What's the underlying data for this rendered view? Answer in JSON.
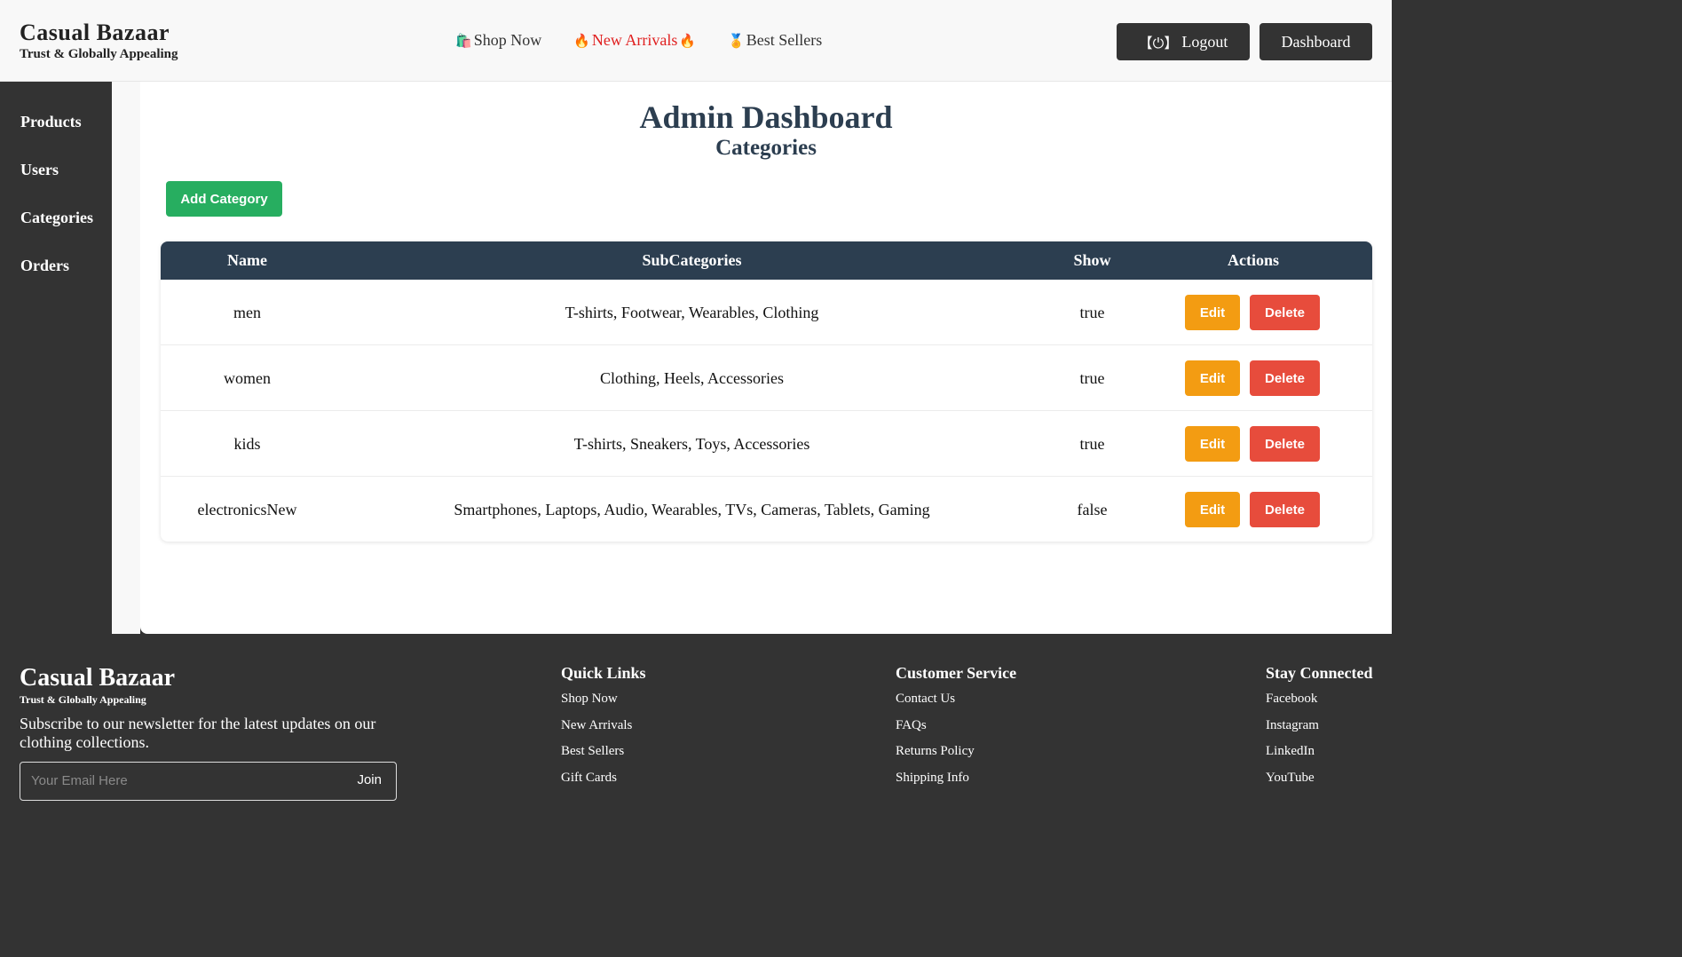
{
  "header": {
    "brand_name": "Casual Bazaar",
    "brand_tagline": "Trust & Globally Appealing",
    "nav": [
      {
        "icon": "🛍️",
        "label": "Shop Now"
      },
      {
        "icon": "🔥",
        "label": "New Arrivals",
        "icon_after": "🔥"
      },
      {
        "icon": "🏅",
        "label": "Best Sellers"
      }
    ],
    "logout_icon": "【⏻】",
    "logout_label": "Logout",
    "dashboard_label": "Dashboard"
  },
  "sidebar": {
    "items": [
      {
        "label": "Products"
      },
      {
        "label": "Users"
      },
      {
        "label": "Categories"
      },
      {
        "label": "Orders"
      }
    ]
  },
  "main": {
    "title": "Admin Dashboard",
    "subtitle": "Categories",
    "add_button_label": "Add Category",
    "table": {
      "headers": [
        "Name",
        "SubCategories",
        "Show",
        "Actions"
      ],
      "rows": [
        {
          "name": "men",
          "subcategories": "T-shirts, Footwear, Wearables, Clothing",
          "show": "true"
        },
        {
          "name": "women",
          "subcategories": "Clothing, Heels, Accessories",
          "show": "true"
        },
        {
          "name": "kids",
          "subcategories": "T-shirts, Sneakers, Toys, Accessories",
          "show": "true"
        },
        {
          "name": "electronicsNew",
          "subcategories": "Smartphones, Laptops, Audio, Wearables, TVs, Cameras, Tablets, Gaming",
          "show": "false"
        }
      ],
      "edit_label": "Edit",
      "delete_label": "Delete"
    }
  },
  "footer": {
    "brand_name": "Casual Bazaar",
    "brand_tagline": "Trust & Globally Appealing",
    "newsletter_text": "Subscribe to our newsletter for the latest updates on our clothing collections.",
    "email_placeholder": "Your Email Here",
    "join_label": "Join",
    "columns": [
      {
        "title": "Quick Links",
        "links": [
          "Shop Now",
          "New Arrivals",
          "Best Sellers",
          "Gift Cards"
        ]
      },
      {
        "title": "Customer Service",
        "links": [
          "Contact Us",
          "FAQs",
          "Returns Policy",
          "Shipping Info"
        ]
      },
      {
        "title": "Stay Connected",
        "links": [
          "Facebook",
          "Instagram",
          "LinkedIn",
          "YouTube"
        ]
      }
    ]
  },
  "colors": {
    "dark": "#333333",
    "navy": "#2c3e50",
    "add_green": "#27ae60",
    "edit_orange": "#f39c12",
    "delete_red": "#e74c3c",
    "hot_red": "#e02020"
  }
}
